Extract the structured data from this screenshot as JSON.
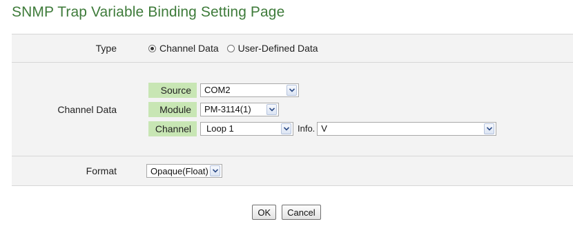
{
  "page": {
    "title": "SNMP Trap Variable Binding Setting Page"
  },
  "type_row": {
    "label": "Type",
    "options": [
      {
        "label": "Channel Data",
        "checked": true
      },
      {
        "label": "User-Defined Data",
        "checked": false
      }
    ]
  },
  "channel_row": {
    "label": "Channel Data",
    "source": {
      "tag": "Source",
      "value": "COM2"
    },
    "module": {
      "tag": "Module",
      "value": "PM-3114(1)"
    },
    "channel": {
      "tag": "Channel",
      "value": "Loop 1"
    },
    "info": {
      "label": "Info.",
      "value": "V"
    }
  },
  "format_row": {
    "label": "Format",
    "value": "Opaque(Float)"
  },
  "buttons": {
    "ok": "OK",
    "cancel": "Cancel"
  },
  "colors": {
    "title": "#3e7b3a",
    "tag_bg": "#c8e6b4",
    "row_bg": "#f3f3f3"
  }
}
